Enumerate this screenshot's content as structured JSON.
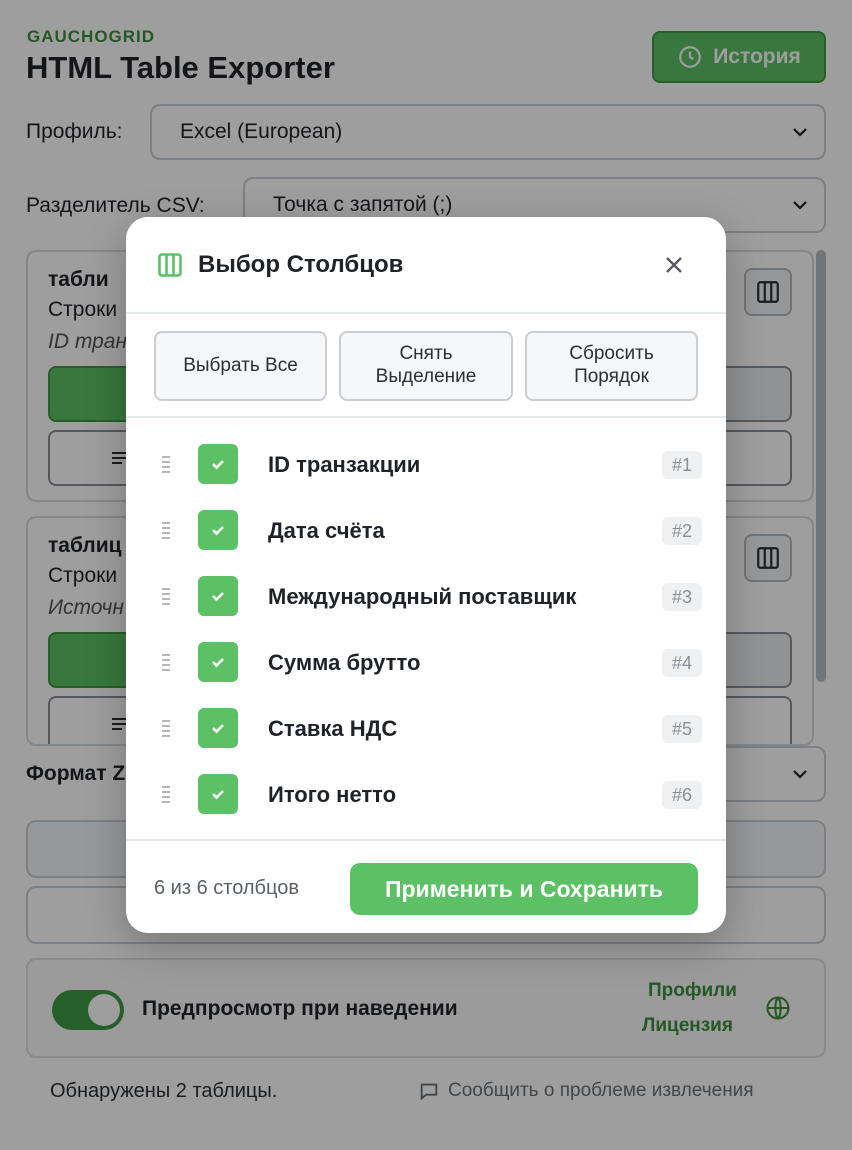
{
  "app": {
    "brand": "GAUCHOGRID",
    "title": "HTML Table Exporter",
    "history_label": "История",
    "profile_label": "Профиль:",
    "profile_value": "Excel (European)",
    "delimiter_label": "Разделитель CSV:",
    "delimiter_value": "Точка с запятой (;)",
    "cards": [
      {
        "title": "табли",
        "sub": "Строки",
        "meta": "ID тран"
      },
      {
        "title": "таблиц",
        "sub": "Строки",
        "meta": "Источн"
      }
    ],
    "format_label": "Формат Z",
    "preview_label": "Предпросмотр при наведении",
    "link_profiles": "Профили",
    "link_license": "Лицензия",
    "found_text": "Обнаружены 2 таблицы.",
    "report_text": "Сообщить о проблеме извлечения"
  },
  "modal": {
    "title": "Выбор Столбцов",
    "actions": {
      "select_all": "Выбрать Все",
      "deselect_line1": "Снять",
      "deselect_line2": "Выделение",
      "reset_line1": "Сбросить",
      "reset_line2": "Порядок"
    },
    "columns": [
      {
        "name": "ID транзакции",
        "badge": "#1",
        "checked": true
      },
      {
        "name": "Дата счёта",
        "badge": "#2",
        "checked": true
      },
      {
        "name": "Международный поставщик",
        "badge": "#3",
        "checked": true
      },
      {
        "name": "Сумма брутто",
        "badge": "#4",
        "checked": true
      },
      {
        "name": "Ставка НДС",
        "badge": "#5",
        "checked": true
      },
      {
        "name": "Итого нетто",
        "badge": "#6",
        "checked": true
      }
    ],
    "count_text": "6 из 6 столбцов",
    "apply_label": "Применить и Сохранить"
  },
  "colors": {
    "accent": "#5cc165",
    "accent_dark": "#3e9a45",
    "brand_text": "#3a8f3a"
  }
}
